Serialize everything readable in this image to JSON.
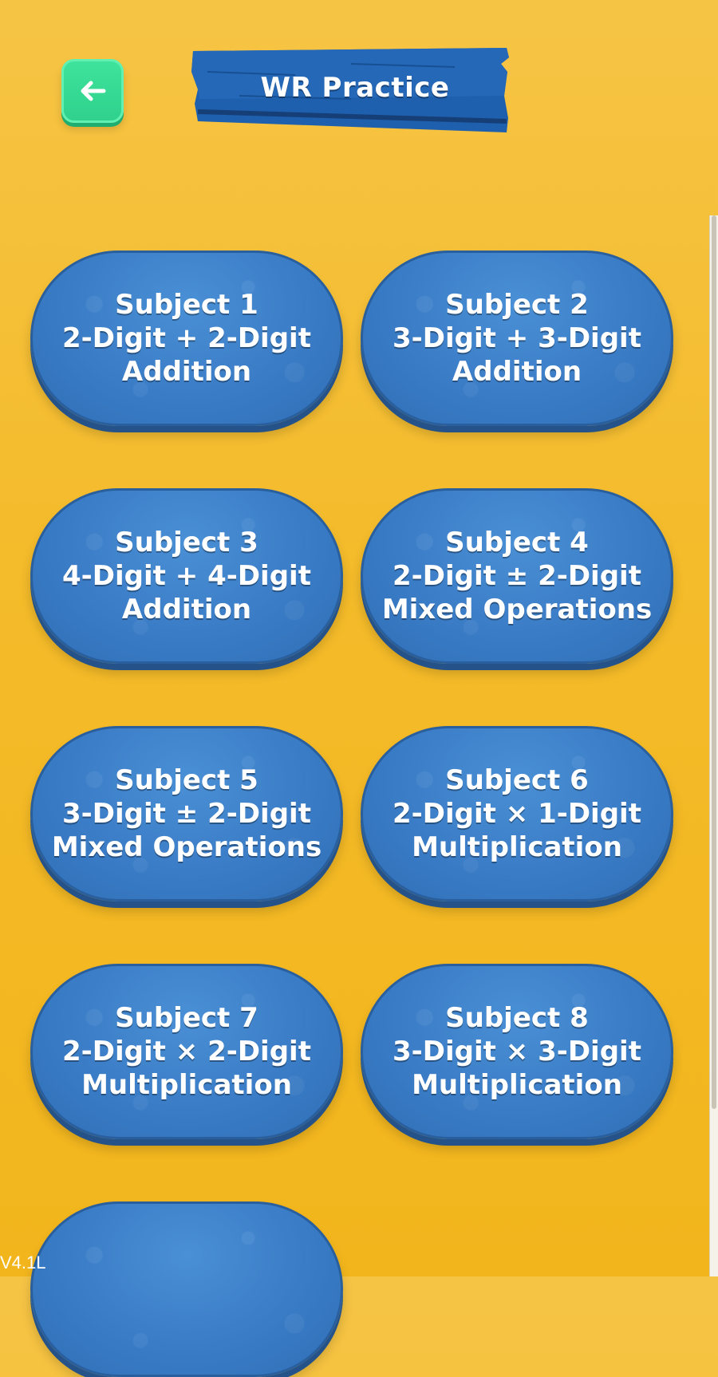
{
  "header": {
    "title": "WR Practice",
    "back_icon": "arrow-left-icon"
  },
  "subjects": [
    {
      "line1": "Subject 1",
      "line2": "2-Digit + 2-Digit",
      "line3": "Addition"
    },
    {
      "line1": "Subject 2",
      "line2": "3-Digit + 3-Digit",
      "line3": "Addition"
    },
    {
      "line1": "Subject 3",
      "line2": "4-Digit + 4-Digit",
      "line3": "Addition"
    },
    {
      "line1": "Subject 4",
      "line2": "2-Digit ± 2-Digit",
      "line3": "Mixed Operations"
    },
    {
      "line1": "Subject 5",
      "line2": "3-Digit ± 2-Digit",
      "line3": "Mixed Operations"
    },
    {
      "line1": "Subject 6",
      "line2": "2-Digit × 1-Digit",
      "line3": "Multiplication"
    },
    {
      "line1": "Subject 7",
      "line2": "2-Digit × 2-Digit",
      "line3": "Multiplication"
    },
    {
      "line1": "Subject 8",
      "line2": "3-Digit × 3-Digit",
      "line3": "Multiplication"
    }
  ],
  "version": "V4.1L",
  "colors": {
    "background": "#f4bb2a",
    "button_blue": "#3a7cc6",
    "back_green": "#2fd18c",
    "banner_blue": "#1f63b0"
  }
}
